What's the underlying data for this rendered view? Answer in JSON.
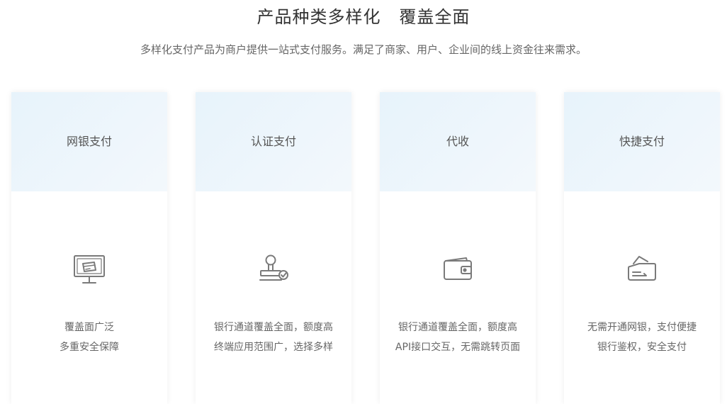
{
  "header": {
    "title": "产品种类多样化   覆盖全面",
    "subtitle": "多样化支付产品为商户提供一站式支付服务。满足了商家、用户、企业间的线上资金往来需求。"
  },
  "cards": [
    {
      "title": "网银支付",
      "icon": "monitor-card-icon",
      "lines": [
        "覆盖面广泛",
        "多重安全保障"
      ]
    },
    {
      "title": "认证支付",
      "icon": "stamp-check-icon",
      "lines": [
        "银行通道覆盖全面，额度高",
        "终端应用范围广，选择多样"
      ]
    },
    {
      "title": "代收",
      "icon": "wallet-icon",
      "lines": [
        "银行通道覆盖全面，额度高",
        "API接口交互，无需跳转页面"
      ]
    },
    {
      "title": "快捷支付",
      "icon": "card-pocket-icon",
      "lines": [
        "无需开通网银，支付便捷",
        "银行鉴权，安全支付"
      ]
    }
  ],
  "colors": {
    "head_gradient_start": "#e7f3fb",
    "head_gradient_end": "#f3f8fc",
    "icon_stroke": "#7a7a7a"
  }
}
